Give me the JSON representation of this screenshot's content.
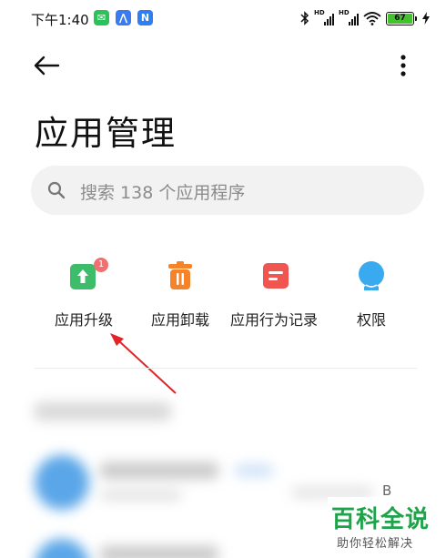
{
  "status_bar": {
    "time": "下午1:40",
    "battery": "67",
    "hd1": "HD",
    "hd2": "HD",
    "app_icons": [
      "wechat-icon",
      "app-store-icon",
      "note-app-icon"
    ],
    "icons": [
      "bluetooth-icon",
      "signal-icon",
      "signal-icon",
      "wifi-icon",
      "battery-icon",
      "charging-icon"
    ]
  },
  "header": {
    "back_icon": "back-arrow-icon",
    "more_icon": "more-vertical-icon"
  },
  "page": {
    "title": "应用管理"
  },
  "search": {
    "placeholder": "搜索 138 个应用程序",
    "icon": "search-icon"
  },
  "quick_actions": [
    {
      "label": "应用升级",
      "icon": "app-upgrade-icon",
      "badge": "1",
      "color": "#3dbd6a"
    },
    {
      "label": "应用卸载",
      "icon": "uninstall-trash-icon",
      "color": "#f5832a"
    },
    {
      "label": "应用行为记录",
      "icon": "behavior-record-icon",
      "color": "#f0564f"
    },
    {
      "label": "权限",
      "icon": "permission-icon",
      "color": "#3aaaf0"
    }
  ],
  "watermark": {
    "main": "百科全说",
    "sub": "助你轻松解决",
    "stray": "B"
  },
  "colors": {
    "annotation_arrow": "#e0242a",
    "search_bg": "#f2f2f2"
  }
}
